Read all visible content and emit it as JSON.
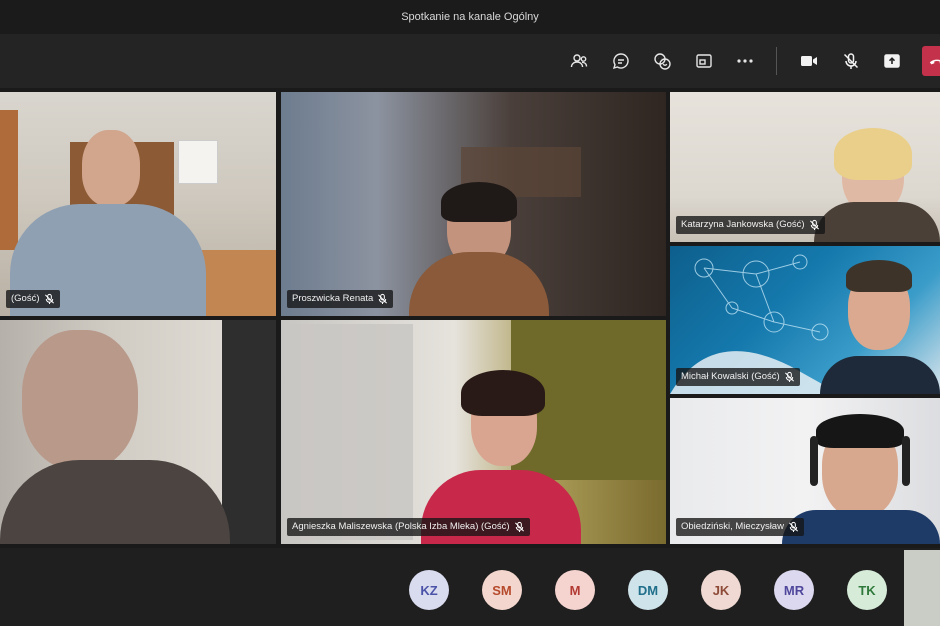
{
  "window": {
    "title": "Spotkanie na kanale Ogólny"
  },
  "toolbar": {
    "buttons": [
      {
        "name": "participants-button",
        "icon": "people-icon"
      },
      {
        "name": "chat-button",
        "icon": "chat-icon"
      },
      {
        "name": "reactions-button",
        "icon": "reactions-icon"
      },
      {
        "name": "rooms-button",
        "icon": "rooms-icon"
      },
      {
        "name": "more-actions-button",
        "icon": "more-icon"
      },
      {
        "name": "camera-button",
        "icon": "camera-icon"
      },
      {
        "name": "mic-button",
        "icon": "mic-off-icon"
      },
      {
        "name": "share-button",
        "icon": "share-icon"
      },
      {
        "name": "leave-button",
        "icon": "hangup-icon"
      }
    ],
    "leave_color": "#c4314b"
  },
  "participants": [
    {
      "id": "p1",
      "name": "(Gość)",
      "muted": true
    },
    {
      "id": "p2",
      "name": "Proszwicka Renata",
      "muted": true
    },
    {
      "id": "p3",
      "name": "Katarzyna Jankowska (Gość)",
      "muted": true
    },
    {
      "id": "p4",
      "name": "Michał Kowalski (Gość)",
      "muted": true
    },
    {
      "id": "p5",
      "name": "",
      "muted": false
    },
    {
      "id": "p6",
      "name": "Agnieszka Maliszewska (Polska Izba Mleka) (Gość)",
      "muted": true
    },
    {
      "id": "p7",
      "name": "Obiedziński, Mieczysław",
      "muted": true
    }
  ],
  "roster": {
    "avatars": [
      {
        "initials": "KZ",
        "bg": "#d9dcef",
        "fg": "#4b53a8"
      },
      {
        "initials": "SM",
        "bg": "#f3d6cd",
        "fg": "#b64a2c"
      },
      {
        "initials": "M",
        "bg": "#f5d4d0",
        "fg": "#b23a33"
      },
      {
        "initials": "DM",
        "bg": "#cfe3ea",
        "fg": "#1f6f8b"
      },
      {
        "initials": "JK",
        "bg": "#efd9d2",
        "fg": "#8e4a37"
      },
      {
        "initials": "MR",
        "bg": "#dcd8ef",
        "fg": "#4f479c"
      },
      {
        "initials": "TK",
        "bg": "#d6ecd9",
        "fg": "#2f7a3b"
      }
    ]
  }
}
